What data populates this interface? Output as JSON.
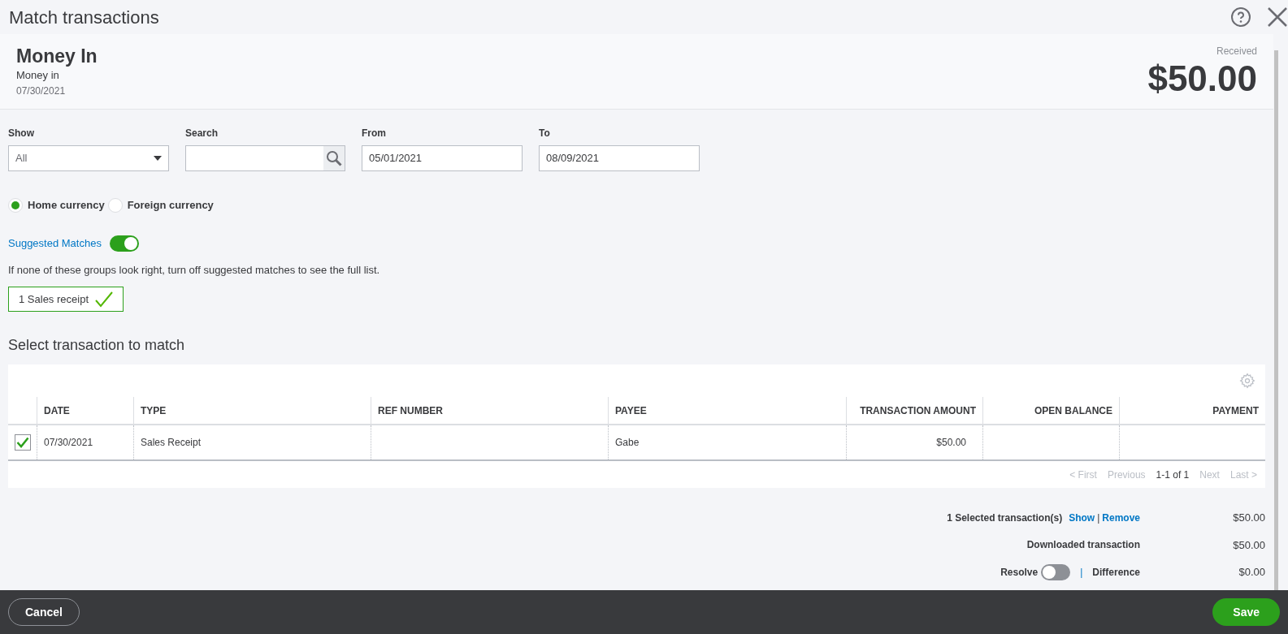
{
  "window": {
    "title": "Match transactions"
  },
  "header": {
    "title": "Money In",
    "subtitle": "Money in",
    "date": "07/30/2021",
    "amount_label": "Received",
    "amount": "$50.00"
  },
  "filters": {
    "show": {
      "label": "Show",
      "value": "All"
    },
    "search": {
      "label": "Search"
    },
    "from": {
      "label": "From",
      "value": "05/01/2021"
    },
    "to": {
      "label": "To",
      "value": "08/09/2021"
    }
  },
  "currency": [
    {
      "label": "Home currency",
      "selected": true
    },
    {
      "label": "Foreign currency",
      "selected": false
    }
  ],
  "suggested_matches": {
    "label": "Suggested Matches",
    "on": true,
    "hint": "If none of these groups look right, turn off suggested matches to see the full list.",
    "groups": [
      {
        "label": "1 Sales receipt",
        "selected": true
      }
    ]
  },
  "table": {
    "title": "Select transaction to match",
    "columns": [
      {
        "label": "DATE",
        "kind": "text"
      },
      {
        "label": "TYPE",
        "kind": "text"
      },
      {
        "label": "REF NUMBER",
        "kind": "text"
      },
      {
        "label": "PAYEE",
        "kind": "text"
      },
      {
        "label": "TRANSACTION AMOUNT",
        "kind": "money"
      },
      {
        "label": "OPEN BALANCE",
        "kind": "money"
      },
      {
        "label": "PAYMENT",
        "kind": "money"
      }
    ],
    "rows": [
      {
        "checked": true,
        "cells": [
          "07/30/2021",
          "Sales Receipt",
          "",
          "Gabe",
          "$50.00",
          "",
          ""
        ]
      }
    ],
    "pagination": [
      {
        "label": "< First",
        "disabled": true
      },
      {
        "label": "Previous",
        "disabled": true
      },
      {
        "label": "1-1 of 1",
        "disabled": false
      },
      {
        "label": "Next",
        "disabled": true
      },
      {
        "label": "Last >",
        "disabled": true
      }
    ]
  },
  "summary": {
    "selected": {
      "label": "1 Selected transaction(s)",
      "show": "Show",
      "separator": "|",
      "remove": "Remove",
      "amount": "$50.00"
    },
    "downloaded": {
      "label": "Downloaded transaction",
      "amount": "$50.00"
    },
    "resolve": {
      "label": "Resolve",
      "on": false,
      "separator": "|"
    },
    "difference": {
      "label": "Difference",
      "amount": "$0.00"
    }
  },
  "footer": {
    "cancel": "Cancel",
    "save": "Save"
  }
}
